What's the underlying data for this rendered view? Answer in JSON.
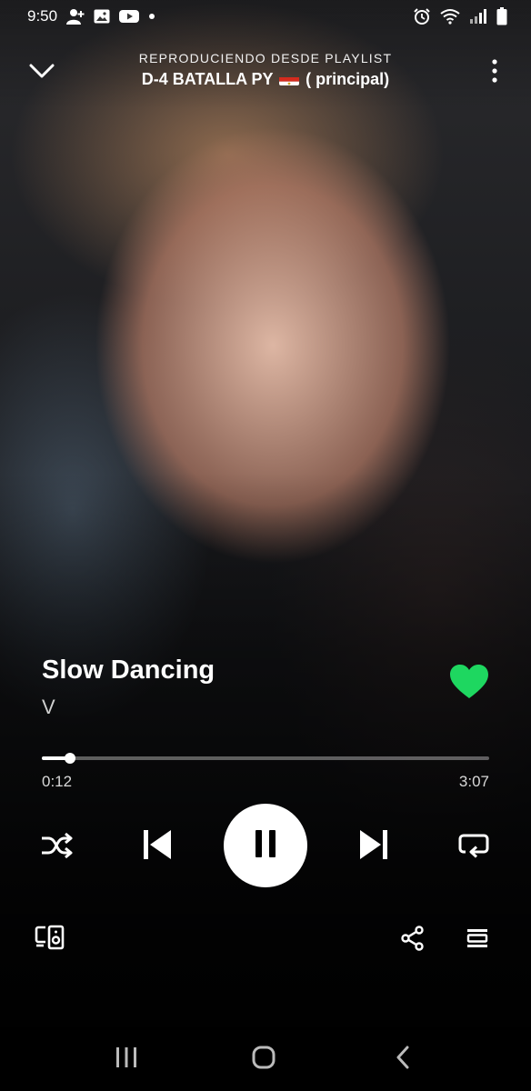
{
  "status_bar": {
    "time": "9:50",
    "left_icons": [
      "person-add-icon",
      "image-icon",
      "youtube-icon",
      "dot-icon"
    ],
    "right_icons": [
      "alarm-icon",
      "wifi-icon",
      "signal-icon",
      "battery-icon"
    ]
  },
  "header": {
    "context_label": "REPRODUCIENDO DESDE PLAYLIST",
    "playlist_name_prefix": "D-4 BATALLA PY",
    "playlist_name_suffix": "( principal)",
    "flag": "paraguay-flag",
    "collapse_icon": "chevron-down-icon",
    "menu_icon": "more-vertical-icon"
  },
  "track": {
    "title": "Slow Dancing",
    "artist": "V",
    "liked": true
  },
  "progress": {
    "elapsed": "0:12",
    "total": "3:07",
    "fraction": 0.064
  },
  "controls": {
    "shuffle_icon": "shuffle-icon",
    "previous_icon": "skip-previous-icon",
    "play_pause_icon": "pause-icon",
    "next_icon": "skip-next-icon",
    "repeat_icon": "repeat-icon"
  },
  "bottom": {
    "devices_icon": "devices-icon",
    "share_icon": "share-icon",
    "queue_icon": "queue-icon"
  },
  "nav": {
    "recents_icon": "recents-icon",
    "home_icon": "home-icon",
    "back_icon": "back-icon"
  },
  "colors": {
    "accent_green": "#1ED760",
    "text_primary": "#FFFFFF",
    "text_secondary": "#CFCFCF"
  }
}
